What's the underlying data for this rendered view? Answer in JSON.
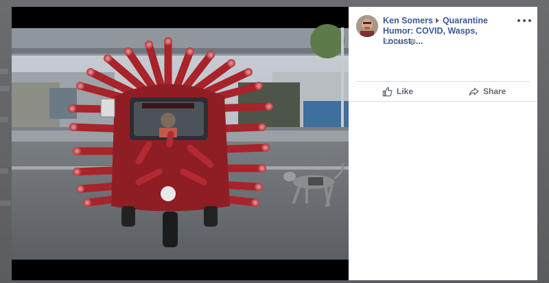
{
  "post": {
    "author": "Ken Somers",
    "group": "Quarantine Humor: COVID, Wasps, Locusts...",
    "timestamp": "22 hrs",
    "separator": "·",
    "privacy_icon": "globe-icon"
  },
  "actions": {
    "like_label": "Like",
    "share_label": "Share"
  },
  "colors": {
    "link": "#385898",
    "secondary_text": "#90949c",
    "action_text": "#606770",
    "photo_letterbox": "#000000",
    "vehicle": "#a8232a",
    "backdrop": "#5e6063"
  },
  "icons": [
    "more-options-icon",
    "thumbs-up-icon",
    "share-arrow-icon",
    "globe-icon"
  ]
}
